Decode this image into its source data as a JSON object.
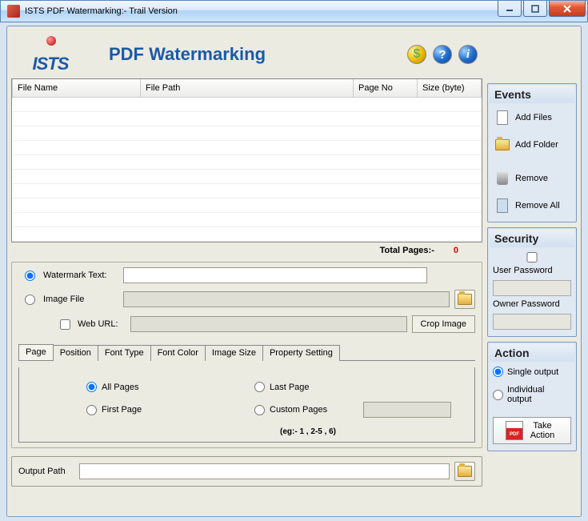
{
  "window": {
    "title": "ISTS PDF Watermarking:- Trail Version"
  },
  "header": {
    "app_title": "PDF Watermarking",
    "logo_text": "ISTS"
  },
  "grid": {
    "columns": [
      "File Name",
      "File Path",
      "Page No",
      "Size (byte)"
    ],
    "total_label": "Total Pages:-",
    "total_value": "0"
  },
  "watermark": {
    "text_label": "Watermark Text:",
    "image_label": "Image File",
    "url_label": "Web URL:",
    "crop_label": "Crop Image",
    "text_value": "",
    "image_value": "",
    "url_value": ""
  },
  "tabs": [
    "Page",
    "Position",
    "Font Type",
    "Font Color",
    "Image Size",
    "Property Setting"
  ],
  "page_opts": {
    "all": "All Pages",
    "last": "Last  Page",
    "first": "First Page",
    "custom": "Custom Pages",
    "eg": "(eg:- 1 , 2-5 , 6)"
  },
  "output": {
    "label": "Output Path",
    "value": ""
  },
  "events": {
    "title": "Events",
    "add_files": "Add Files",
    "add_folder": "Add Folder",
    "remove": "Remove",
    "remove_all": "Remove All"
  },
  "security": {
    "title": "Security",
    "user_pw": "User Password",
    "owner_pw": "Owner Password"
  },
  "action": {
    "title": "Action",
    "single": "Single output",
    "individual": "Individual output",
    "take": "Take Action"
  }
}
